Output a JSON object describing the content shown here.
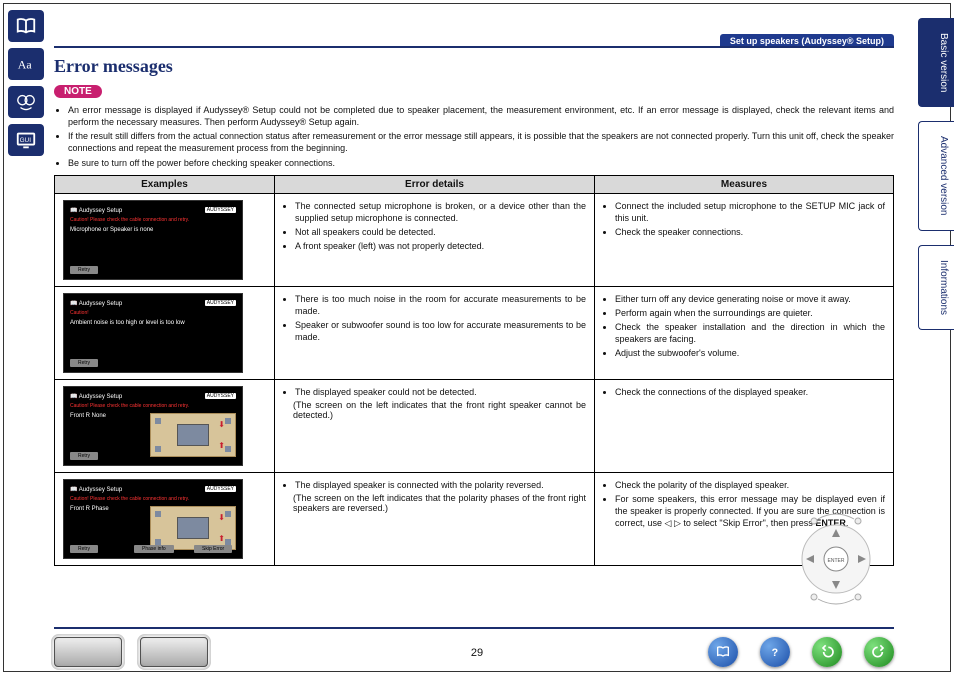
{
  "breadcrumb": "Set up speakers (Audyssey® Setup)",
  "page_title": "Error messages",
  "note_label": "NOTE",
  "intro_bullets": [
    "An error message is displayed if Audyssey® Setup could not be completed due to speaker placement, the measurement environment, etc. If an error message is displayed, check the relevant items and perform the necessary measures. Then perform Audyssey® Setup again.",
    "If the result still differs from the actual connection status after remeasurement or the error message still appears, it is possible that the speakers are not connected properly. Turn this unit off, check the speaker connections and repeat the measurement process from the beginning.",
    "Be sure to turn off the power before checking speaker connections."
  ],
  "table": {
    "headers": {
      "examples": "Examples",
      "details": "Error details",
      "measures": "Measures"
    },
    "rows": [
      {
        "mock": {
          "title": "Audyssey Setup",
          "logo": "AUDYSSEY",
          "caution": "Caution!  Please check the cable connection and retry.",
          "line": "Microphone or Speaker is none",
          "room": false,
          "buttons": [
            "Retry"
          ]
        },
        "details": [
          "The connected setup microphone is broken, or a device other than the supplied setup microphone is connected.",
          "Not all speakers could be detected.",
          "A front speaker (left) was not properly detected."
        ],
        "measures": [
          "Connect the included setup microphone to the SETUP MIC jack of this unit.",
          "Check the speaker connections."
        ]
      },
      {
        "mock": {
          "title": "Audyssey Setup",
          "logo": "AUDYSSEY",
          "caution": "Caution!",
          "line": "Ambient noise is too high or level is too low",
          "room": false,
          "buttons": [
            "Retry"
          ]
        },
        "details": [
          "There is too much noise in the room for accurate measurements to be made.",
          "Speaker or subwoofer sound is too low for accurate measurements to be made."
        ],
        "measures": [
          "Either turn off any device generating noise or move it away.",
          "Perform again when the surroundings are quieter.",
          "Check the speaker installation and the direction in which the speakers are facing.",
          "Adjust the subwoofer's volume."
        ]
      },
      {
        "mock": {
          "title": "Audyssey Setup",
          "logo": "AUDYSSEY",
          "caution": "Caution!  Please check the cable connection and retry.",
          "line": "Front R        None",
          "room": true,
          "buttons": [
            "Retry"
          ]
        },
        "details": [
          "The displayed speaker could not be detected."
        ],
        "details_sub": "(The screen on the left indicates that the front right speaker cannot be detected.)",
        "measures": [
          "Check the connections of the displayed speaker."
        ]
      },
      {
        "mock": {
          "title": "Audyssey Setup",
          "logo": "AUDYSSEY",
          "caution": "Caution!  Please check the cable connection and retry.",
          "line": "Front R        Phase",
          "room": true,
          "buttons": [
            "Retry",
            "Phase info",
            "Skip Error"
          ]
        },
        "details": [
          "The displayed speaker is connected with the polarity reversed."
        ],
        "details_sub": "(The screen on the left indicates that the polarity phases of the front right speakers are reversed.)",
        "measures": [
          "Check the polarity of the displayed speaker.",
          "For some speakers, this error message may be displayed even if the speaker is properly connected. If you are sure the connection is correct, use ◁ ▷ to select \"Skip Error\", then press ENTER."
        ]
      }
    ]
  },
  "tabs": {
    "basic": "Basic version",
    "advanced": "Advanced version",
    "info": "Informations"
  },
  "page_number": "29",
  "icons": {
    "rail_book": "open-book-icon",
    "rail_aa": "font-size-icon",
    "rail_gui": "gui-icon",
    "footer_book": "manual-icon",
    "footer_help": "help-icon",
    "footer_back": "history-back-icon",
    "footer_fwd": "history-forward-icon",
    "footer_dev1": "receiver-front-icon",
    "footer_dev2": "receiver-rear-icon"
  }
}
